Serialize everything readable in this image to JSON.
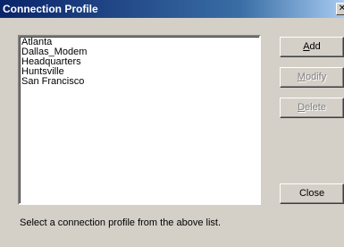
{
  "window": {
    "title": "Connection Profile",
    "close_glyph": "✕"
  },
  "profiles": [
    "Atlanta",
    "Dallas_Modem",
    "Headquarters",
    "Huntsville",
    "San Francisco"
  ],
  "buttons": {
    "add": {
      "accel": "A",
      "rest": "dd",
      "enabled": true
    },
    "modify": {
      "accel": "M",
      "rest": "odify",
      "enabled": false
    },
    "delete": {
      "accel": "D",
      "rest": "elete",
      "enabled": false
    },
    "close": {
      "label": "Close",
      "enabled": true
    }
  },
  "status_text": "Select a connection profile from the above list.",
  "colors": {
    "title_gradient_start": "#0a246a",
    "title_gradient_end": "#a6caf0",
    "face": "#d4d0c8",
    "disabled_text": "#808080"
  }
}
